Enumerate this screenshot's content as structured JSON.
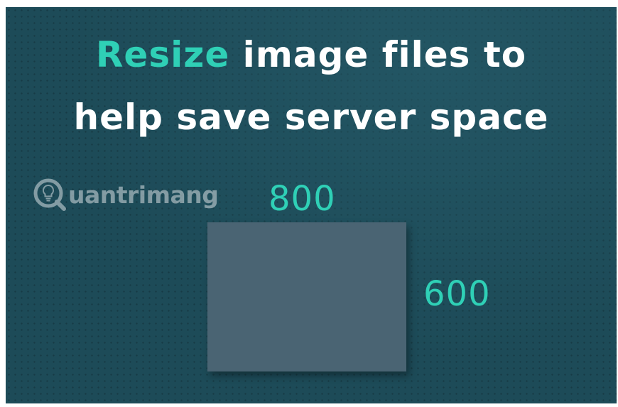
{
  "headline": {
    "line1_accent": "Resize",
    "line1_rest": " image files to",
    "line2": "help save server space"
  },
  "watermark": {
    "text": "uantrimang",
    "icon": "lightbulb-q-logo"
  },
  "dimensions": {
    "width_label": "800",
    "height_label": "600"
  },
  "colors": {
    "background": "#1d4b58",
    "accent": "#2fd0b6",
    "text": "#ffffff",
    "box": "#4a6473"
  }
}
